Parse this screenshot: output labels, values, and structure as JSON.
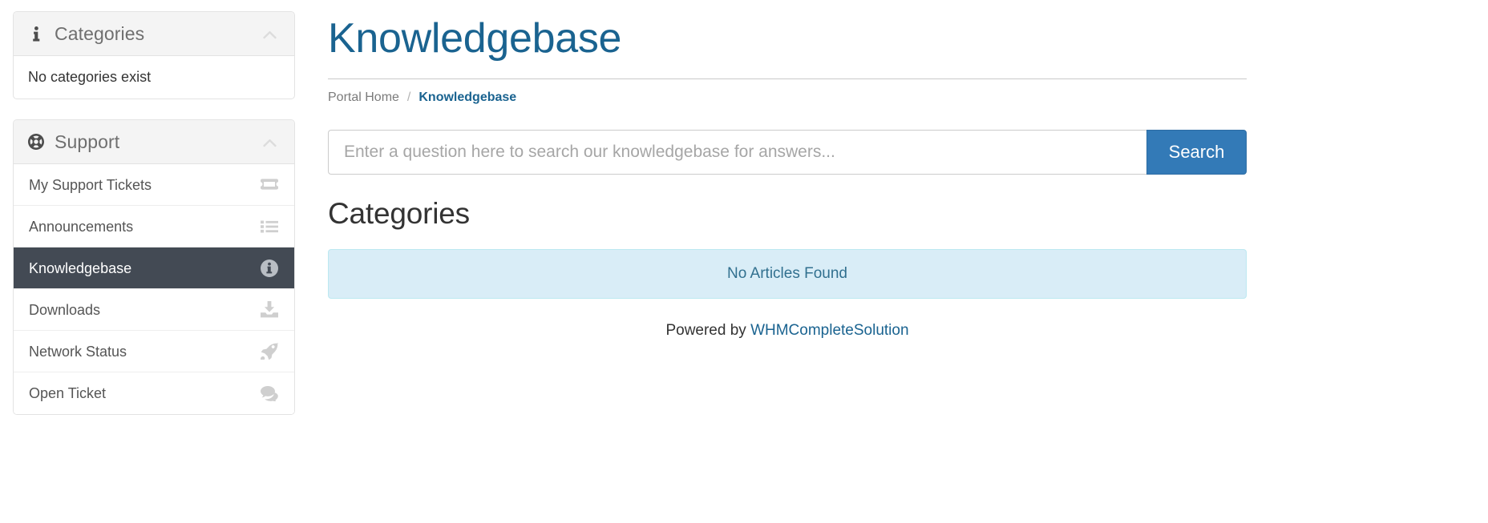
{
  "sidebar": {
    "categories_panel": {
      "title": "Categories",
      "icon": "info-icon",
      "collapse_icon": "chevron-up-icon",
      "empty_text": "No categories exist"
    },
    "support_panel": {
      "title": "Support",
      "icon": "lifebuoy-icon",
      "collapse_icon": "chevron-up-icon",
      "items": [
        {
          "label": "My Support Tickets",
          "icon": "ticket-icon",
          "active": false
        },
        {
          "label": "Announcements",
          "icon": "list-icon",
          "active": false
        },
        {
          "label": "Knowledgebase",
          "icon": "info-circle-icon",
          "active": true
        },
        {
          "label": "Downloads",
          "icon": "download-inbox-icon",
          "active": false
        },
        {
          "label": "Network Status",
          "icon": "rocket-icon",
          "active": false
        },
        {
          "label": "Open Ticket",
          "icon": "comments-icon",
          "active": false
        }
      ]
    }
  },
  "main": {
    "page_title": "Knowledgebase",
    "breadcrumb": {
      "home": "Portal Home",
      "separator": "/",
      "current": "Knowledgebase"
    },
    "search": {
      "placeholder": "Enter a question here to search our knowledgebase for answers...",
      "value": "",
      "button_label": "Search"
    },
    "section_title": "Categories",
    "alert_text": "No Articles Found",
    "footer": {
      "prefix": "Powered by ",
      "link_label": "WHMCompleteSolution"
    }
  },
  "colors": {
    "title_blue": "#1a6390",
    "active_nav_bg": "#434a54",
    "primary_button": "#337ab7",
    "alert_bg": "#d9edf7",
    "alert_border": "#bce8f1",
    "alert_text": "#31708f"
  }
}
